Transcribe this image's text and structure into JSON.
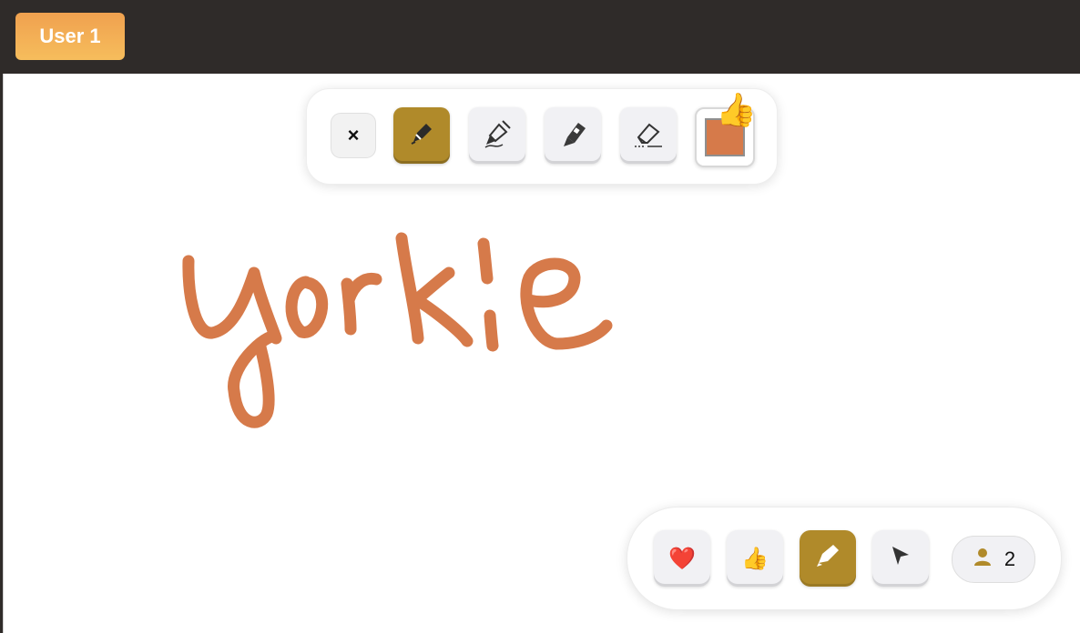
{
  "header": {
    "user_label": "User 1"
  },
  "toolbar": {
    "close_symbol": "×",
    "tools": [
      {
        "name": "pen",
        "icon": "pen-icon",
        "active": true
      },
      {
        "name": "fountain-pen",
        "icon": "fountain-pen-icon",
        "active": false
      },
      {
        "name": "highlighter",
        "icon": "highlighter-icon",
        "active": false
      },
      {
        "name": "eraser",
        "icon": "eraser-icon",
        "active": false
      }
    ],
    "color_swatch": "#d67a4a",
    "reaction_emoji": "👍"
  },
  "drawing": {
    "stroke_color": "#d67a4a"
  },
  "bottombar": {
    "heart_emoji": "❤️",
    "thumb_emoji": "👍",
    "users_count": "2",
    "active_color": "#b08a2a"
  }
}
